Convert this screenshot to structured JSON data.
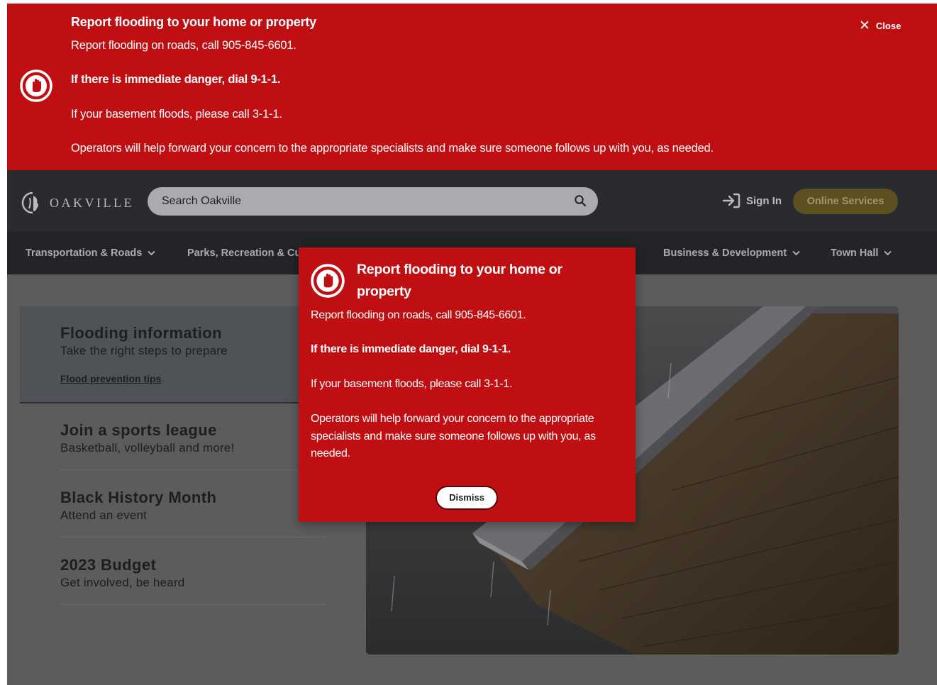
{
  "alert": {
    "title": "Report flooding to your home or property",
    "line1": "Report flooding on roads, call 905-845-6601.",
    "line2": "If there is immediate danger, dial 9-1-1.",
    "line3": "If your basement floods, please call 3-1-1.",
    "line4": "Operators will help forward your concern to the appropriate specialists and make sure someone follows up with you, as needed.",
    "close_label": "Close",
    "icon": "stop-hand-icon"
  },
  "header": {
    "logo_text": "OAKVILLE",
    "search_placeholder": "Search Oakville",
    "sign_in_label": "Sign In",
    "online_services_label": "Online Services"
  },
  "nav": {
    "items": [
      {
        "label": "Transportation & Roads"
      },
      {
        "label": "Parks, Recreation & Cul"
      },
      {
        "label": "Business & Development"
      },
      {
        "label": "Town Hall"
      }
    ]
  },
  "features": [
    {
      "title": "Flooding information",
      "subtitle": "Take the right steps to prepare",
      "link": "Flood prevention tips"
    },
    {
      "title": "Join a sports league",
      "subtitle": "Basketball, volleyball and more!"
    },
    {
      "title": "Black History Month",
      "subtitle": "Attend an event"
    },
    {
      "title": "2023 Budget",
      "subtitle": "Get involved, be heard"
    }
  ],
  "modal": {
    "title": "Report flooding to your home or property",
    "line1": "Report flooding on roads, call 905-845-6601.",
    "line2": "If there is immediate danger, dial 9-1-1.",
    "line3": "If your basement floods, please call 3-1-1.",
    "line4": "Operators will help forward your concern to the appropriate specialists and make sure someone follows up with you, as needed.",
    "dismiss_label": "Dismiss",
    "icon": "stop-hand-icon"
  },
  "colors": {
    "alert_red": "#c00f12",
    "header_navy": "#003366",
    "online_services_gold": "#c9a53a"
  }
}
